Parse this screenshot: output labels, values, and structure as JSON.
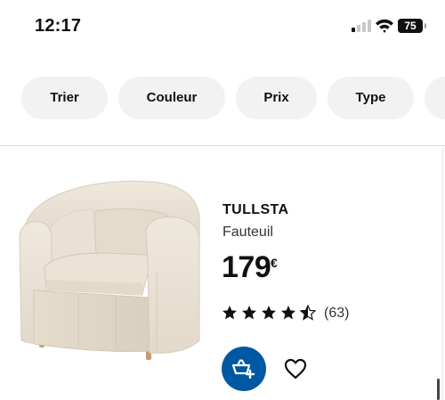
{
  "status_bar": {
    "time": "12:17",
    "battery_level": "75",
    "icons": [
      "cellular-signal-icon",
      "wifi-icon",
      "battery-icon"
    ]
  },
  "filters": [
    {
      "label": "Trier"
    },
    {
      "label": "Couleur"
    },
    {
      "label": "Prix"
    },
    {
      "label": "Type"
    }
  ],
  "product": {
    "brand": "TULLSTA",
    "type": "Fauteuil",
    "price": "179",
    "currency": "€",
    "rating_stars": 4.5,
    "reviews": "(63)",
    "add_to_cart_icon": "basket-plus-icon",
    "favorite_icon": "heart-icon",
    "image_icon": "armchair-image"
  },
  "colors": {
    "accent": "#0058a3",
    "chip_background": "#f2f2f2",
    "text": "#111111"
  }
}
